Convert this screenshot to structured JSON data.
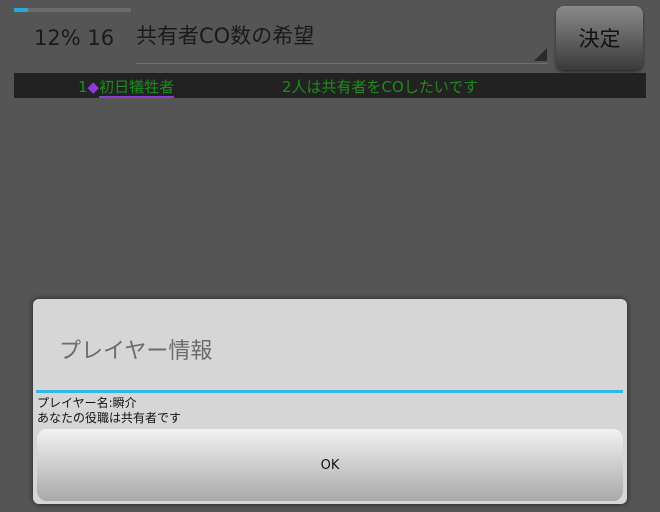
{
  "header": {
    "progress_percent": 12,
    "counter_text": "12% 16",
    "spinner_value": "共有者CO数の希望",
    "decide_label": "決定"
  },
  "ticker": {
    "item1_number": "1",
    "item1_diamond": "◆",
    "item1_name": "初日犠牲者",
    "item2_text": "2人は共有者をCOしたいです"
  },
  "dialog": {
    "title": "プレイヤー情報",
    "line1": "プレイヤー名:瞬介",
    "line2": "あなたの役職は共有者です",
    "ok_label": "OK"
  },
  "colors": {
    "accent": "#33b5e5",
    "ticker_text": "#1e8c1e",
    "ticker_highlight": "#8e3bd6"
  }
}
